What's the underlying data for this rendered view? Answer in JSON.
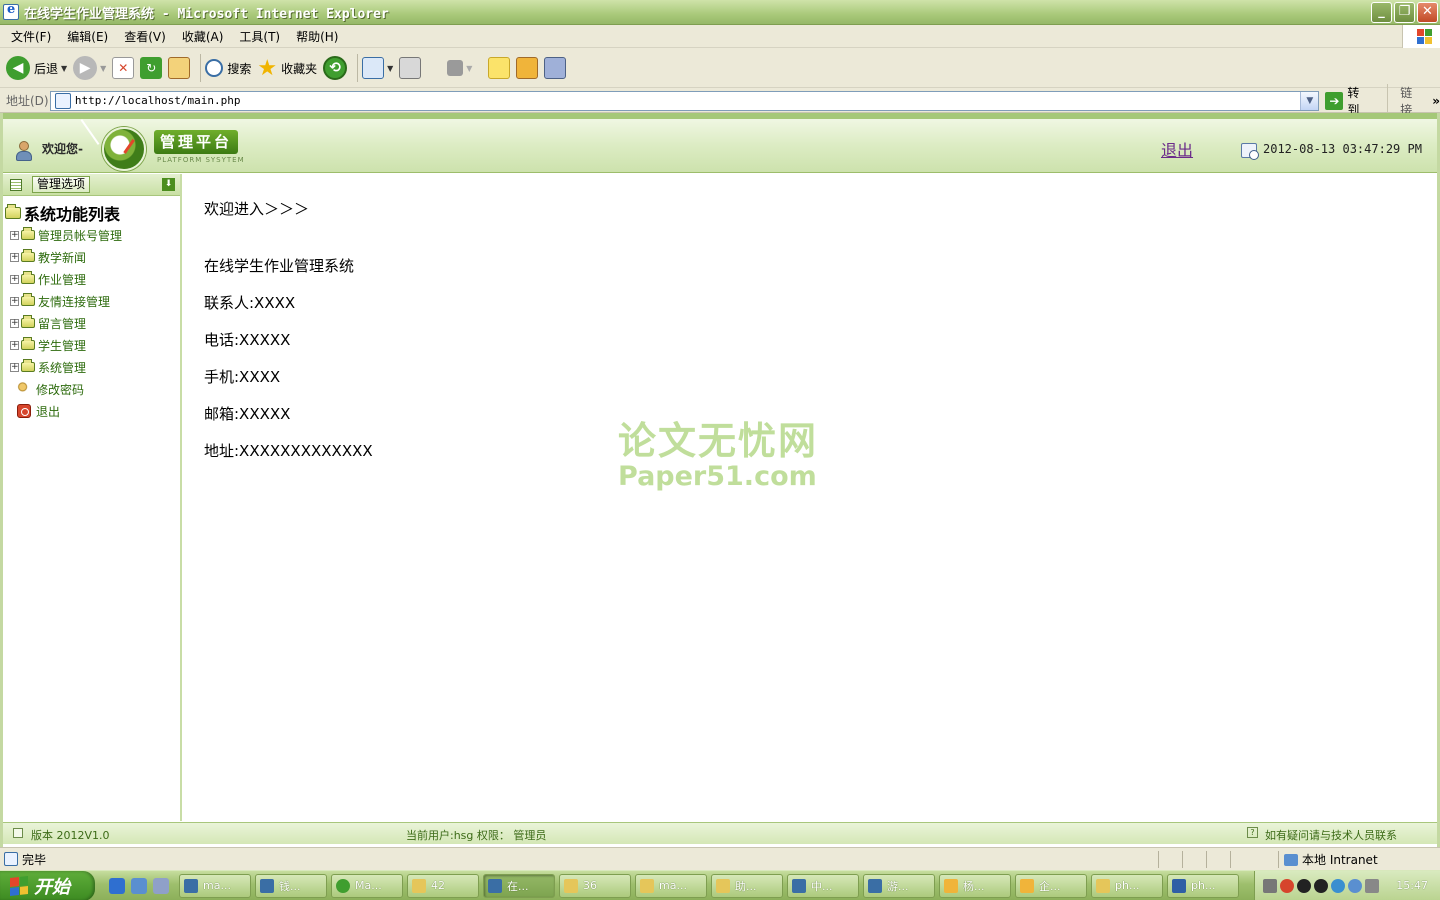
{
  "window": {
    "title": "在线学生作业管理系统 - Microsoft Internet Explorer",
    "buttons": {
      "minimize": "_",
      "maximize": "❐",
      "close": "✕"
    }
  },
  "menu": [
    "文件(F)",
    "编辑(E)",
    "查看(V)",
    "收藏(A)",
    "工具(T)",
    "帮助(H)"
  ],
  "toolbar": {
    "back_label": "后退",
    "search_label": "搜索",
    "favorites_label": "收藏夹"
  },
  "address": {
    "label": "地址(D)",
    "url": "http://localhost/main.php",
    "go_label": "转到",
    "links_label": "链接"
  },
  "header": {
    "welcome": "欢迎您-",
    "platform_title": "管理平台",
    "platform_subtitle": "PLATFORM SYSYTEM",
    "logout": "退出",
    "datetime": "2012-08-13 03:47:29 PM"
  },
  "sidebar": {
    "tab_label": "管理选项",
    "root": "系统功能列表",
    "folders": [
      {
        "label": "管理员帐号管理"
      },
      {
        "label": "教学新闻"
      },
      {
        "label": "作业管理"
      },
      {
        "label": "友情连接管理"
      },
      {
        "label": "留言管理"
      },
      {
        "label": "学生管理"
      },
      {
        "label": "系统管理"
      }
    ],
    "leaves": [
      {
        "label": "修改密码",
        "icon": "key-icon"
      },
      {
        "label": "退出",
        "icon": "exit-icon"
      }
    ]
  },
  "main": {
    "breadcrumb": "欢迎进入＞＞＞",
    "system_name": "在线学生作业管理系统",
    "contact": "联系人:XXXX",
    "phone": "电话:XXXXX",
    "mobile": "手机:XXXX",
    "email": "邮箱:XXXXX",
    "address": "地址:XXXXXXXXXXXXX"
  },
  "watermark": {
    "line1": "论文无忧网",
    "line2": "Paper51.com"
  },
  "footer": {
    "version": "版本 2012V1.0",
    "current_user": "当前用户:hsg 权限： 管理员",
    "contact": "如有疑问请与技术人员联系"
  },
  "statusbar": {
    "status": "完毕",
    "zone": "本地 Intranet"
  },
  "taskbar": {
    "start": "开始",
    "tasks": [
      {
        "label": "ma...",
        "color": "#3a6ea5"
      },
      {
        "label": "钱...",
        "color": "#3a6ea5"
      },
      {
        "label": "Ma...",
        "color": "#3f9e2f"
      },
      {
        "label": "42",
        "color": "#e5c65a"
      },
      {
        "label": "在...",
        "color": "#3a6ea5",
        "active": true
      },
      {
        "label": "36",
        "color": "#e5c65a"
      },
      {
        "label": "ma...",
        "color": "#e5c65a"
      },
      {
        "label": "助...",
        "color": "#e5c65a"
      },
      {
        "label": "中...",
        "color": "#3a6ea5"
      },
      {
        "label": "游...",
        "color": "#3a6ea5"
      },
      {
        "label": "杨...",
        "color": "#f0b43a"
      },
      {
        "label": "企...",
        "color": "#f0b43a"
      },
      {
        "label": "ph...",
        "color": "#e5c65a"
      },
      {
        "label": "ph...",
        "color": "#2f5fa5"
      }
    ],
    "clock": "15:47"
  }
}
